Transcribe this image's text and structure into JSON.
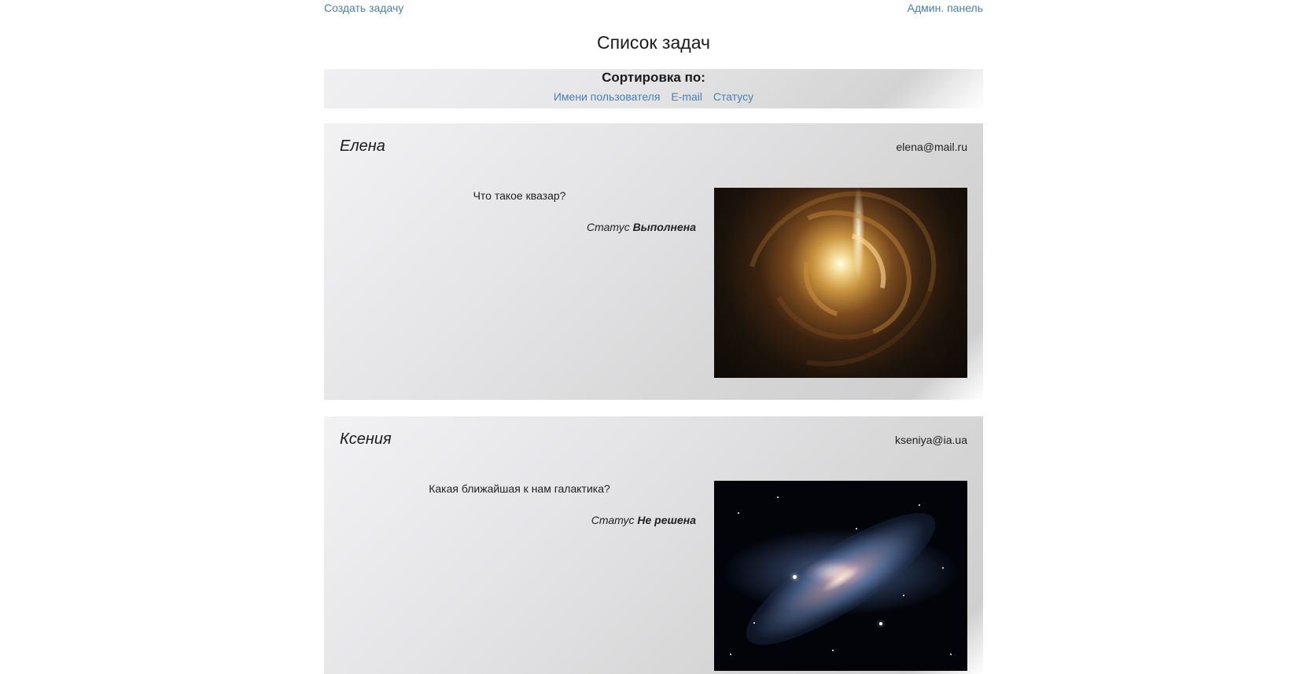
{
  "nav": {
    "create_task": "Создать задачу",
    "admin_panel": "Админ. панель"
  },
  "page_title": "Список задач",
  "sort": {
    "title": "Сортировка по:",
    "options": [
      "Имени пользователя",
      "E-mail",
      "Статусу"
    ]
  },
  "tasks": [
    {
      "user": "Елена",
      "email": "elena@mail.ru",
      "text": "Что такое квазар?",
      "status_label": "Статус",
      "status_value": "Выполнена",
      "image": "quasar-image"
    },
    {
      "user": "Ксения",
      "email": "kseniya@ia.ua",
      "text": "Какая ближайшая к нам галактика?",
      "status_label": "Статус",
      "status_value": "Не решена",
      "image": "galaxy-image"
    }
  ],
  "colors": {
    "link": "#4a7fb0",
    "card_gradient_start": "#f2f1f4",
    "card_gradient_end": "#cfcfcf"
  }
}
